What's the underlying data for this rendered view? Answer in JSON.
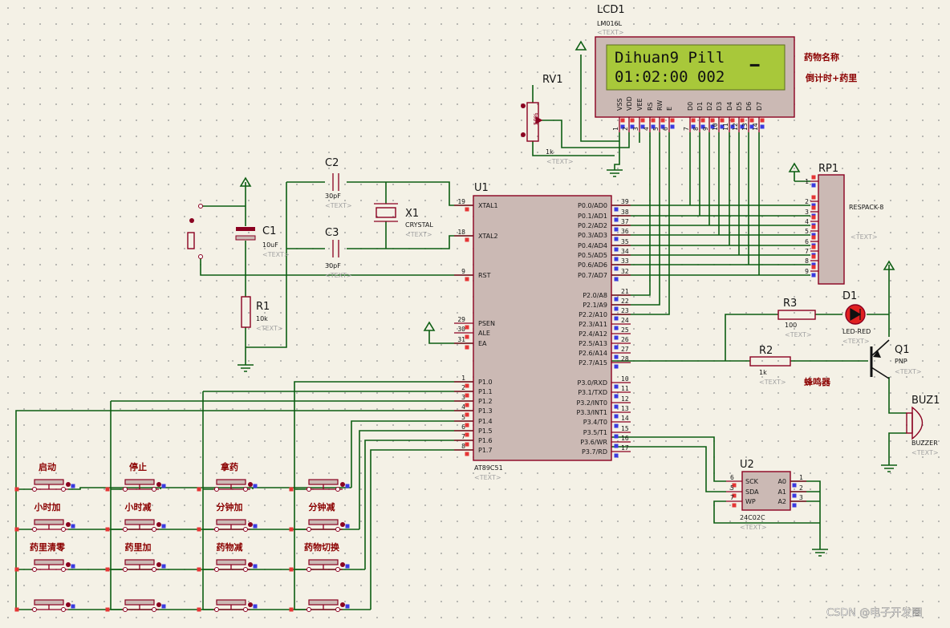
{
  "lcd": {
    "ref": "LCD1",
    "model": "LM016L",
    "text_tag": "<TEXT>",
    "line1": "Dihuan9 Pill",
    "line2": "01:02:00   002",
    "cursor": "▁",
    "note1": "药物名称",
    "note2": "倒计时+药里",
    "pins": [
      "VSS",
      "VDD",
      "VEE",
      "RS",
      "RW",
      "E",
      "D0",
      "D1",
      "D2",
      "D3",
      "D4",
      "D5",
      "D6",
      "D7"
    ],
    "pin_nums": [
      "1",
      "2",
      "3",
      "4",
      "5",
      "6",
      "7",
      "8",
      "9",
      "10",
      "11",
      "12",
      "13",
      "14"
    ]
  },
  "rv1": {
    "ref": "RV1",
    "value": "1k",
    "text_tag": "<TEXT>",
    "pct": "50%"
  },
  "c1": {
    "ref": "C1",
    "value": "10uF",
    "text_tag": "<TEXT>"
  },
  "c2": {
    "ref": "C2",
    "value": "30pF",
    "text_tag": "<TEXT>"
  },
  "c3": {
    "ref": "C3",
    "value": "30pF",
    "text_tag": "<TEXT>"
  },
  "x1": {
    "ref": "X1",
    "value": "CRYSTAL",
    "text_tag": "<TEXT>"
  },
  "r1": {
    "ref": "R1",
    "value": "10k",
    "text_tag": "<TEXT>"
  },
  "r2": {
    "ref": "R2",
    "value": "1k",
    "text_tag": "<TEXT>",
    "note": "蜂鸣器"
  },
  "r3": {
    "ref": "R3",
    "value": "100",
    "text_tag": "<TEXT>"
  },
  "d1": {
    "ref": "D1",
    "value": "LED-RED",
    "text_tag": "<TEXT>"
  },
  "q1": {
    "ref": "Q1",
    "value": "PNP",
    "text_tag": "<TEXT>"
  },
  "buz1": {
    "ref": "BUZ1",
    "value": "BUZZER",
    "text_tag": "<TEXT>"
  },
  "rp1": {
    "ref": "RP1",
    "value": "RESPACK-8",
    "text_tag": "<TEXT>",
    "pin_nums": [
      "1",
      "2",
      "3",
      "4",
      "5",
      "6",
      "7",
      "8",
      "9"
    ]
  },
  "u1": {
    "ref": "U1",
    "value": "AT89C51",
    "text_tag": "<TEXT>",
    "left_pins": [
      {
        "num": "19",
        "name": "XTAL1"
      },
      {
        "num": "18",
        "name": "XTAL2"
      },
      {
        "num": "9",
        "name": "RST"
      },
      {
        "num": "29",
        "name": "PSEN"
      },
      {
        "num": "30",
        "name": "ALE"
      },
      {
        "num": "31",
        "name": "EA"
      },
      {
        "num": "1",
        "name": "P1.0"
      },
      {
        "num": "2",
        "name": "P1.1"
      },
      {
        "num": "3",
        "name": "P1.2"
      },
      {
        "num": "4",
        "name": "P1.3"
      },
      {
        "num": "5",
        "name": "P1.4"
      },
      {
        "num": "6",
        "name": "P1.5"
      },
      {
        "num": "7",
        "name": "P1.6"
      },
      {
        "num": "8",
        "name": "P1.7"
      }
    ],
    "right_pins": [
      {
        "num": "39",
        "name": "P0.0/AD0"
      },
      {
        "num": "38",
        "name": "P0.1/AD1"
      },
      {
        "num": "37",
        "name": "P0.2/AD2"
      },
      {
        "num": "36",
        "name": "P0.3/AD3"
      },
      {
        "num": "35",
        "name": "P0.4/AD4"
      },
      {
        "num": "34",
        "name": "P0.5/AD5"
      },
      {
        "num": "33",
        "name": "P0.6/AD6"
      },
      {
        "num": "32",
        "name": "P0.7/AD7"
      },
      {
        "num": "21",
        "name": "P2.0/A8"
      },
      {
        "num": "22",
        "name": "P2.1/A9"
      },
      {
        "num": "23",
        "name": "P2.2/A10"
      },
      {
        "num": "24",
        "name": "P2.3/A11"
      },
      {
        "num": "25",
        "name": "P2.4/A12"
      },
      {
        "num": "26",
        "name": "P2.5/A13"
      },
      {
        "num": "27",
        "name": "P2.6/A14"
      },
      {
        "num": "28",
        "name": "P2.7/A15"
      },
      {
        "num": "10",
        "name": "P3.0/RXD"
      },
      {
        "num": "11",
        "name": "P3.1/TXD"
      },
      {
        "num": "12",
        "name": "P3.2/INT0"
      },
      {
        "num": "13",
        "name": "P3.3/INT1"
      },
      {
        "num": "14",
        "name": "P3.4/T0"
      },
      {
        "num": "15",
        "name": "P3.5/T1"
      },
      {
        "num": "16",
        "name": "P3.6/WR"
      },
      {
        "num": "17",
        "name": "P3.7/RD"
      }
    ]
  },
  "u2": {
    "ref": "U2",
    "value": "24C02C",
    "text_tag": "<TEXT>",
    "left_pins": [
      {
        "num": "6",
        "name": "SCK"
      },
      {
        "num": "5",
        "name": "SDA"
      },
      {
        "num": "7",
        "name": "WP"
      }
    ],
    "right_pins": [
      {
        "num": "1",
        "name": "A0"
      },
      {
        "num": "2",
        "name": "A1"
      },
      {
        "num": "3",
        "name": "A2"
      }
    ]
  },
  "buttons": [
    [
      "启动",
      "停止",
      "拿药",
      ""
    ],
    [
      "小时加",
      "小时减",
      "分钟加",
      "分钟减"
    ],
    [
      "药里清零",
      "药里加",
      "药物减",
      "药物切换"
    ],
    [
      "",
      "",
      "",
      ""
    ]
  ],
  "watermark": "CSDN @电子开发圈",
  "colors": {
    "wire": "#0c5e12",
    "outline": "#8a0020",
    "body": "#cbb9b4",
    "lcd_screen": "#a8c83a",
    "background": "#f4f1e6"
  }
}
